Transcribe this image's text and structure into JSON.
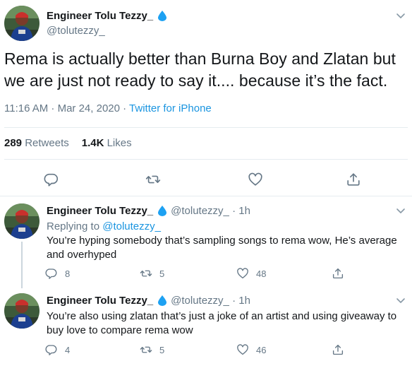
{
  "author": {
    "name": "Engineer Tolu Tezzy_",
    "handle": "@tolutezzy_"
  },
  "main_tweet": {
    "text": "Rema is actually better than Burna Boy and Zlatan but we are just not ready to say it.... because it’s the fact.",
    "time": "11:16 AM · Mar 24, 2020 · ",
    "source": "Twitter for iPhone",
    "retweets_count": "289",
    "retweets_label": "Retweets",
    "likes_count": "1.4K",
    "likes_label": "Likes"
  },
  "replies": [
    {
      "name": "Engineer Tolu Tezzy_",
      "handle_time": "@tolutezzy_ · 1h",
      "replying_prefix": "Replying to ",
      "replying_to": "@tolutezzy_",
      "text": "You’re hyping somebody that’s sampling songs to rema wow, He’s average and overhyped",
      "reply_count": "8",
      "retweet_count": "5",
      "like_count": "48"
    },
    {
      "name": "Engineer Tolu Tezzy_",
      "handle_time": "@tolutezzy_ · 1h",
      "text": "You’re also using zlatan that’s just a joke of an artist and using giveaway to buy love to compare rema wow",
      "reply_count": "4",
      "retweet_count": "5",
      "like_count": "46"
    }
  ],
  "icons": {
    "verified": "verified-drop-icon",
    "caret": "chevron-down-icon",
    "reply": "reply-icon",
    "retweet": "retweet-icon",
    "like": "heart-icon",
    "share": "share-icon"
  },
  "colors": {
    "link": "#1b95e0",
    "secondary_text": "#657786",
    "border": "#e6ecf0",
    "verified": "#1da1f2"
  }
}
